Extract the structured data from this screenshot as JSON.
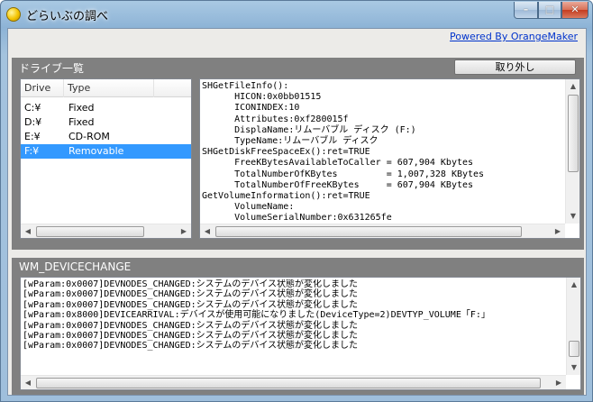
{
  "window": {
    "title": "どらいぶの調べ",
    "controls": {
      "minimize": "–",
      "maximize": "□",
      "close": "✕"
    }
  },
  "header": {
    "powered_link": "Powered By OrangeMaker"
  },
  "drive_panel": {
    "label": "ドライブ一覧",
    "eject_button": "取り外し",
    "columns": [
      "Drive",
      "Type"
    ],
    "rows": [
      {
        "drive": "C:¥",
        "type": "Fixed",
        "selected": false
      },
      {
        "drive": "D:¥",
        "type": "Fixed",
        "selected": false
      },
      {
        "drive": "E:¥",
        "type": "CD-ROM",
        "selected": false
      },
      {
        "drive": "F:¥",
        "type": "Removable",
        "selected": true
      }
    ]
  },
  "info_lines": [
    "SHGetFileInfo():",
    "      HICON:0x0bb01515",
    "      ICONINDEX:10",
    "      Attributes:0xf280015f",
    "      DisplaName:リムーバブル ディスク (F:)",
    "      TypeName:リムーバブル ディスク",
    "SHGetDiskFreeSpaceEx():ret=TRUE",
    "      FreeKBytesAvailableToCaller = 607,904 Kbytes",
    "      TotalNumberOfKBytes         = 1,007,328 KBytes",
    "      TotalNumberOfFreeKBytes     = 607,904 KBytes",
    "GetVolumeInformation():ret=TRUE",
    "      VolumeName:",
    "      VolumeSerialNumber:0x631265fe"
  ],
  "log_panel": {
    "label": "WM_DEVICECHANGE",
    "lines": [
      "[wParam:0x0007]DEVNODES_CHANGED:システムのデバイス状態が変化しました",
      "[wParam:0x0007]DEVNODES_CHANGED:システムのデバイス状態が変化しました",
      "[wParam:0x0007]DEVNODES_CHANGED:システムのデバイス状態が変化しました",
      "[wParam:0x8000]DEVICEARRIVAL:デバイスが使用可能になりました(DeviceType=2)DEVTYP_VOLUME「F:」",
      "[wParam:0x0007]DEVNODES_CHANGED:システムのデバイス状態が変化しました",
      "[wParam:0x0007]DEVNODES_CHANGED:システムのデバイス状態が変化しました",
      "[wParam:0x0007]DEVNODES_CHANGED:システムのデバイス状態が変化しました"
    ]
  },
  "colors": {
    "selection": "#3399ff",
    "group_background": "#808080",
    "link": "#0033cc",
    "close_button": "#c53c1f"
  }
}
